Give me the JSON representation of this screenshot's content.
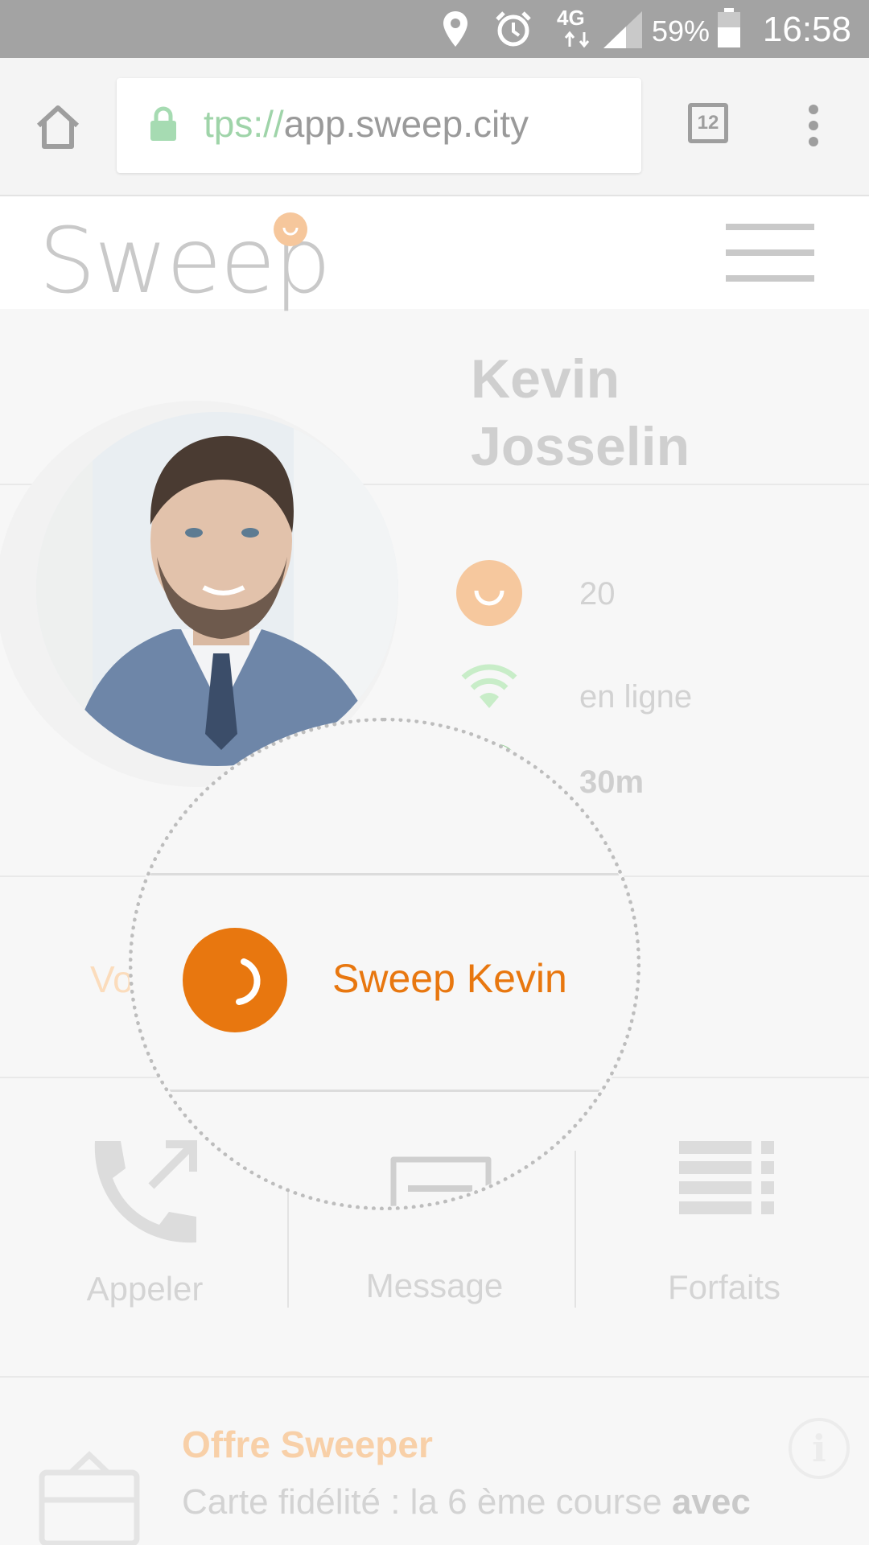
{
  "status_bar": {
    "network": "4G",
    "battery_percent": "59%",
    "time": "16:58",
    "icons": [
      "location-icon",
      "alarm-icon",
      "signal-icon",
      "battery-icon"
    ]
  },
  "browser": {
    "url_scheme": "tps://",
    "url_host": "app.sweep.city",
    "tab_count": "12"
  },
  "site": {
    "logo": "Sweep",
    "accent_color": "#e8770f"
  },
  "profile": {
    "first_name": "Kevin",
    "last_name": "Josselin",
    "score": "20",
    "status": "en ligne",
    "distance": "30m"
  },
  "sweep_button": {
    "label": "Sweep Kevin",
    "partial_hidden_text": "Vo"
  },
  "actions": [
    {
      "label": "Appeler",
      "icon": "phone-call-icon"
    },
    {
      "label": "Message",
      "icon": "message-icon"
    },
    {
      "label": "Forfaits",
      "icon": "list-icon"
    }
  ],
  "offer": {
    "title": "Offre Sweeper",
    "text": "Carte fidélité : la 6 ème course ",
    "text_bold": "avec"
  }
}
